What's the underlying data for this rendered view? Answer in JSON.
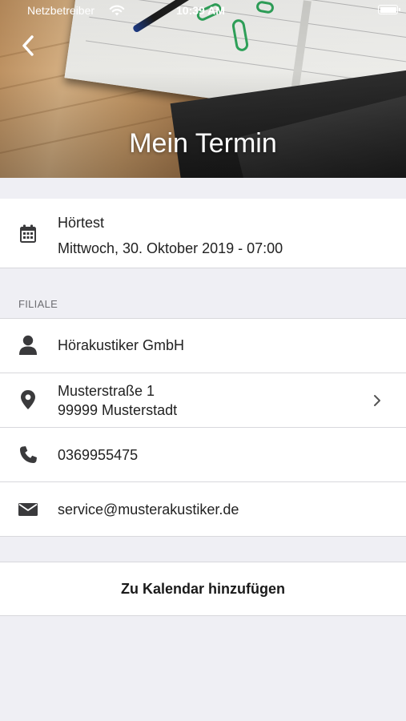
{
  "status_bar": {
    "carrier": "Netzbetreiber",
    "time": "10:39 AM",
    "wifi_icon": "wifi-icon",
    "battery_icon": "battery-icon"
  },
  "header": {
    "back_icon": "chevron-left-icon",
    "title": "Mein Termin"
  },
  "appointment": {
    "icon": "calendar-icon",
    "title": "Hörtest",
    "date": "Mittwoch, 30. Oktober 2019 - 07:00"
  },
  "branch": {
    "section_label": "FILIALE",
    "name_icon": "person-icon",
    "name": "Hörakustiker GmbH",
    "address_icon": "location-pin-icon",
    "street": "Musterstraße 1",
    "city": "99999 Musterstadt",
    "address_chevron_icon": "chevron-right-icon",
    "phone_icon": "phone-icon",
    "phone": "0369955475",
    "email_icon": "mail-icon",
    "email": "service@musterakustiker.de"
  },
  "actions": {
    "add_to_calendar_label": "Zu Kalendar hinzufügen"
  },
  "colors": {
    "background": "#efeff4",
    "cell": "#ffffff",
    "icon": "#3a3a3c",
    "secondary_text": "#8e8e93",
    "separator": "#d8d8dc"
  }
}
